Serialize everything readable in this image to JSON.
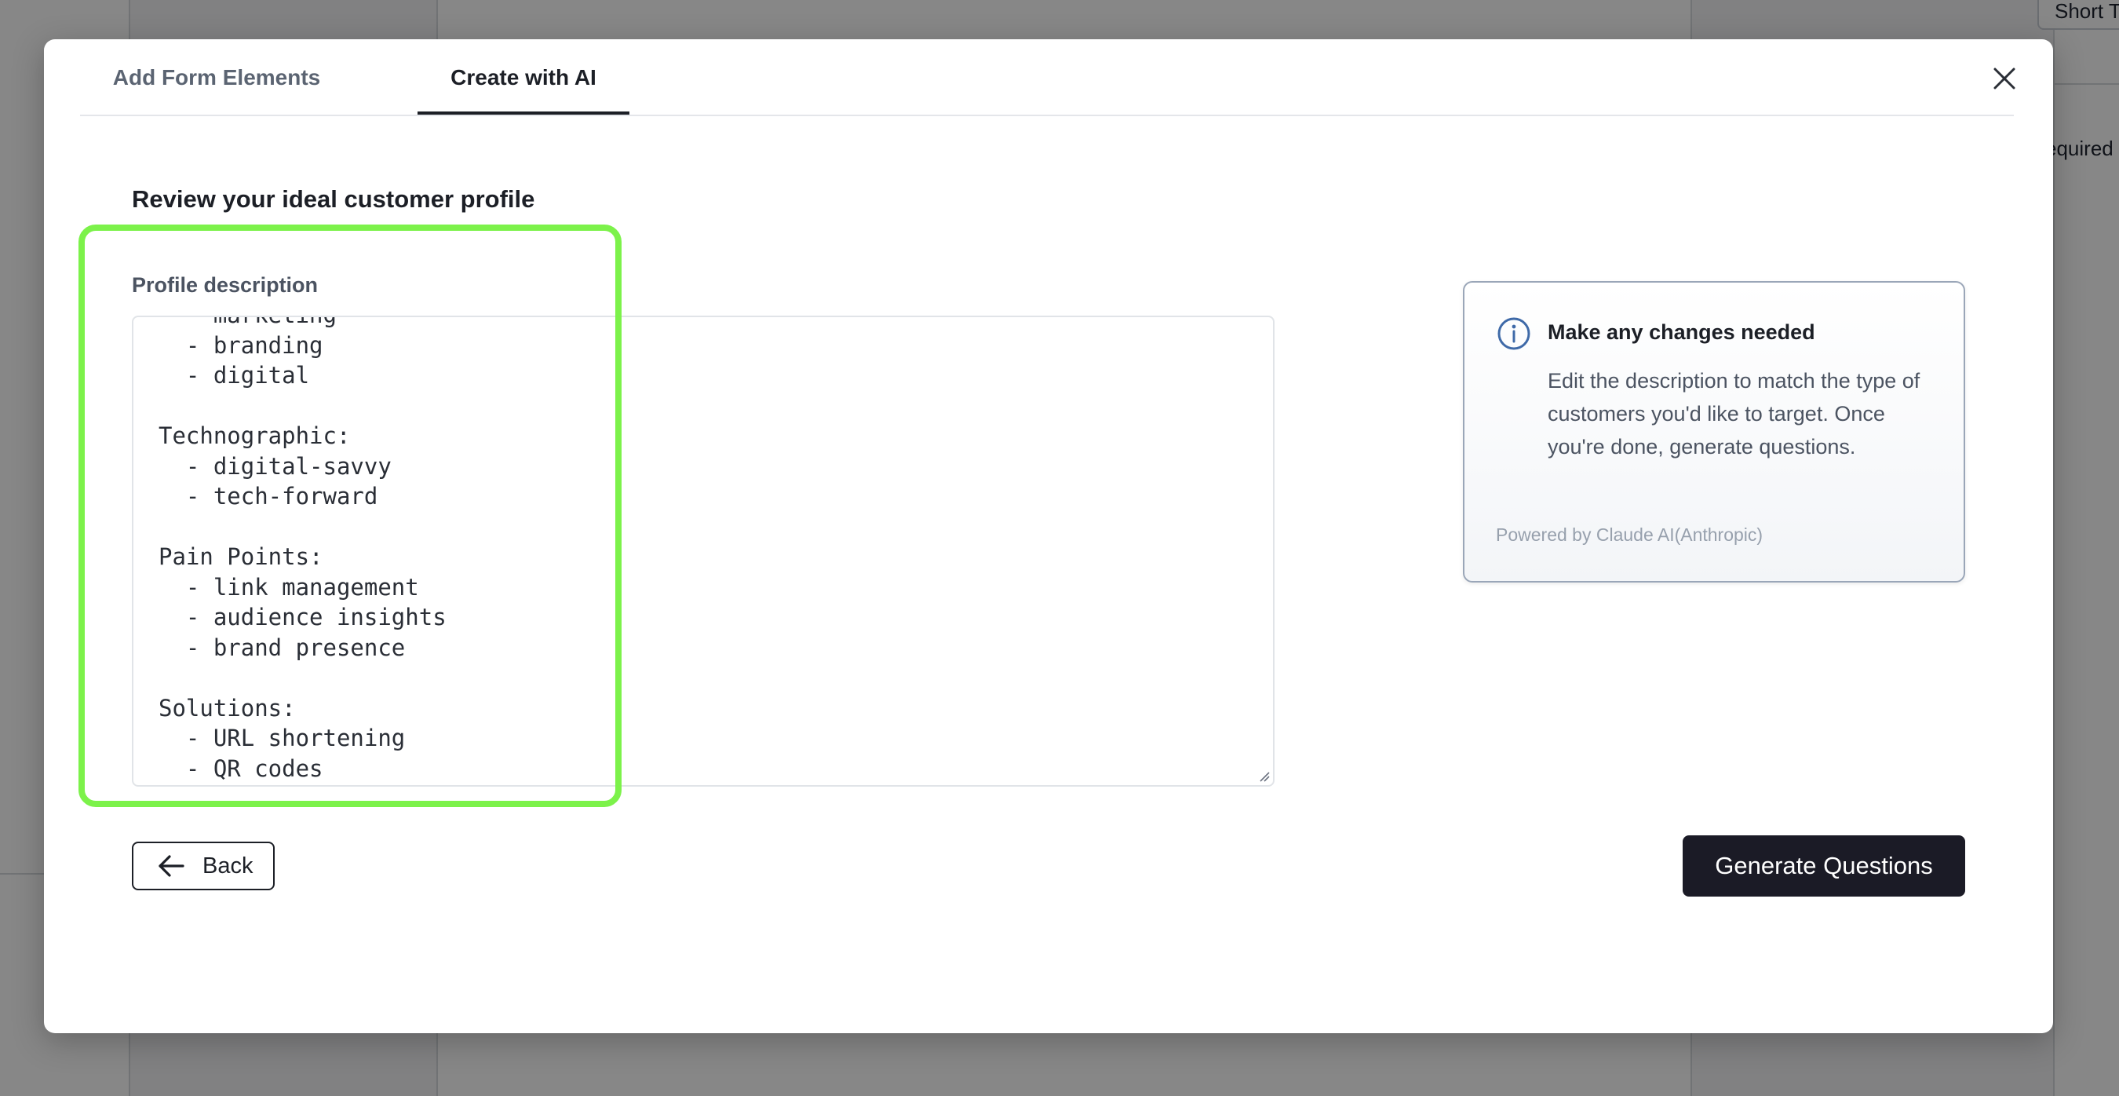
{
  "background": {
    "chip_label": "Short T",
    "required_text": "equired"
  },
  "modal": {
    "tabs": [
      {
        "label": "Add Form Elements",
        "active": false
      },
      {
        "label": "Create with AI",
        "active": true
      }
    ],
    "close_icon": "close-icon",
    "review_title": "Review your ideal customer profile",
    "profile_field": {
      "label": "Profile description",
      "value_visible": "  - marketing\n  - branding\n  - digital\n\nTechnographic:\n  - digital-savvy\n  - tech-forward\n\nPain Points:\n  - link management\n  - audience insights\n  - brand presence\n\nSolutions:\n  - URL shortening\n  - QR codes"
    },
    "info_card": {
      "icon": "info-icon",
      "title": "Make any changes needed",
      "body": "Edit the description to match the type of customers you'd like to target. Once you're done, generate questions.",
      "powered_by": "Powered by Claude AI(Anthropic)"
    },
    "back_button": {
      "label": "Back",
      "icon": "arrow-left-icon"
    },
    "generate_button": {
      "label": "Generate Questions"
    }
  },
  "colors": {
    "highlight": "#7cf24a",
    "primary_button": "#1b1b26",
    "overlay": "rgba(0,0,0,0.47)"
  }
}
